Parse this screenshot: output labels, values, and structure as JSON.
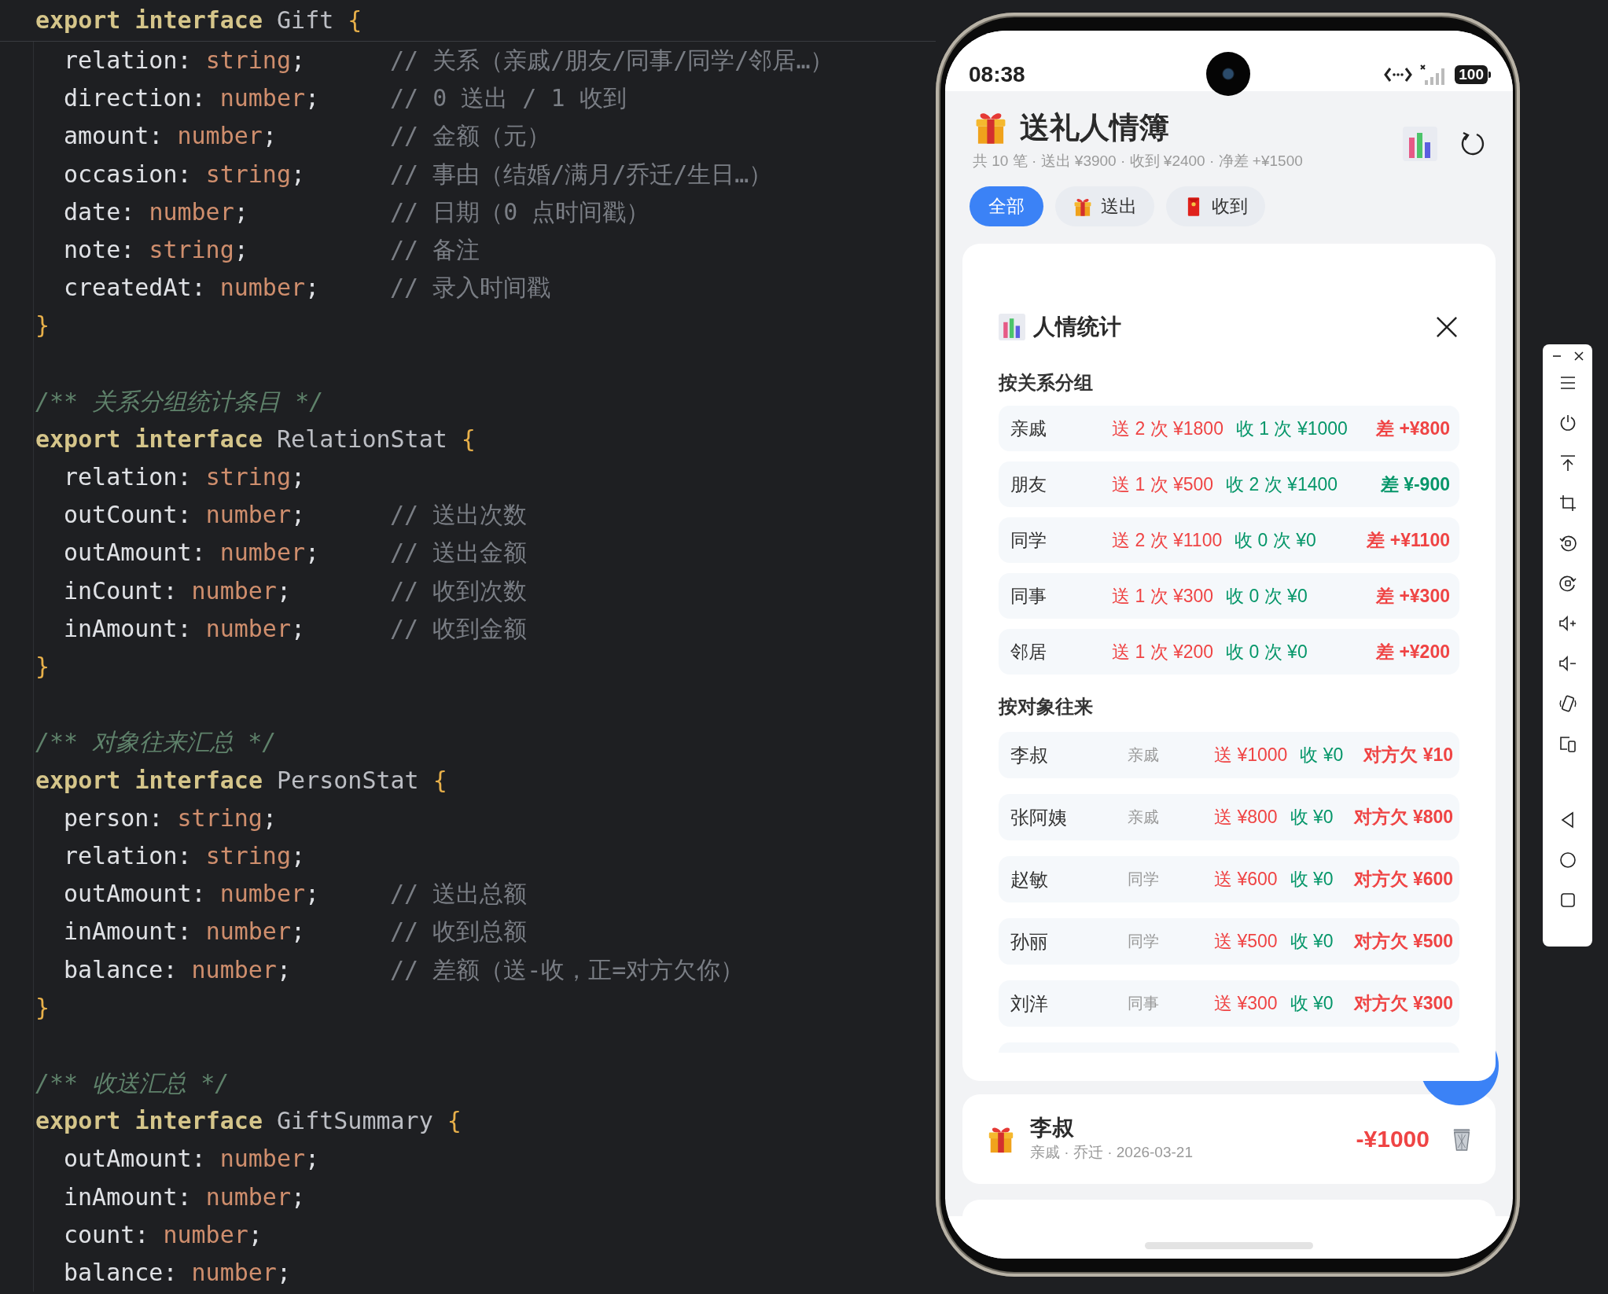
{
  "code": {
    "blocks": [
      {
        "sticky": true,
        "header": {
          "keyword": "export interface",
          "name": "Gift",
          "brace": "{"
        },
        "fields": [
          {
            "name": "relation:",
            "type": "string",
            "end": ";",
            "comment": "// 关系（亲戚/朋友/同事/同学/邻居…）"
          },
          {
            "name": "direction:",
            "type": "number",
            "end": ";",
            "comment": "// 0 送出 / 1 收到"
          },
          {
            "name": "amount:",
            "type": "number",
            "end": ";",
            "comment": "// 金额（元）"
          },
          {
            "name": "occasion:",
            "type": "string",
            "end": ";",
            "comment": "// 事由（结婚/满月/乔迁/生日…）"
          },
          {
            "name": "date:",
            "type": "number",
            "end": ";",
            "comment": "// 日期（0 点时间戳）"
          },
          {
            "name": "note:",
            "type": "string",
            "end": ";",
            "comment": "// 备注"
          },
          {
            "name": "createdAt:",
            "type": "number",
            "end": ";",
            "comment": "// 录入时间戳"
          }
        ],
        "closing": "}"
      },
      {
        "sticky": false,
        "doc": "/** 关系分组统计条目 */",
        "header": {
          "keyword": "export interface",
          "name": "RelationStat",
          "brace": "{"
        },
        "fields": [
          {
            "name": "relation:",
            "type": "string",
            "end": ";"
          },
          {
            "name": "outCount:",
            "type": "number",
            "end": ";",
            "comment": "// 送出次数"
          },
          {
            "name": "outAmount:",
            "type": "number",
            "end": ";",
            "comment": "// 送出金额"
          },
          {
            "name": "inCount:",
            "type": "number",
            "end": ";",
            "comment": "// 收到次数"
          },
          {
            "name": "inAmount:",
            "type": "number",
            "end": ";",
            "comment": "// 收到金额"
          }
        ],
        "closing": "}"
      },
      {
        "sticky": false,
        "doc": "/** 对象往来汇总 */",
        "header": {
          "keyword": "export interface",
          "name": "PersonStat",
          "brace": "{"
        },
        "fields": [
          {
            "name": "person:",
            "type": "string",
            "end": ";"
          },
          {
            "name": "relation:",
            "type": "string",
            "end": ";"
          },
          {
            "name": "outAmount:",
            "type": "number",
            "end": ";",
            "comment": "// 送出总额"
          },
          {
            "name": "inAmount:",
            "type": "number",
            "end": ";",
            "comment": "// 收到总额"
          },
          {
            "name": "balance:",
            "type": "number",
            "end": ";",
            "comment": "// 差额（送-收，正=对方欠你）"
          }
        ],
        "closing": "}"
      },
      {
        "sticky": false,
        "doc": "/** 收送汇总 */",
        "header": {
          "keyword": "export interface",
          "name": "GiftSummary",
          "brace": "{"
        },
        "fields": [
          {
            "name": "outAmount:",
            "type": "number",
            "end": ";"
          },
          {
            "name": "inAmount:",
            "type": "number",
            "end": ";"
          },
          {
            "name": "count:",
            "type": "number",
            "end": ";"
          },
          {
            "name": "balance:",
            "type": "number",
            "end": ";"
          }
        ]
      }
    ]
  },
  "phone": {
    "status_bar": {
      "time": "08:38",
      "battery": "100"
    },
    "header": {
      "title": "送礼人情簿",
      "summary": "共 10 笔 · 送出 ¥3900 · 收到 ¥2400 · 净差 +¥1500"
    },
    "tabs": [
      {
        "kind": "all",
        "label": "全部",
        "selected": true
      },
      {
        "kind": "out",
        "label": "送出",
        "selected": false
      },
      {
        "kind": "in",
        "label": "收到",
        "selected": false
      }
    ],
    "stats": {
      "title": "人情统计",
      "sections": [
        {
          "kind": "relation",
          "title": "按关系分组",
          "rows": [
            {
              "name": "亲戚",
              "out": "送 2 次 ¥1800",
              "in": "收 1 次 ¥1000",
              "diff": "差 +¥800",
              "color": "#ef4444"
            },
            {
              "name": "朋友",
              "out": "送 1 次 ¥500",
              "in": "收 2 次 ¥1400",
              "diff": "差 ¥-900",
              "color": "#059669"
            },
            {
              "name": "同学",
              "out": "送 2 次 ¥1100",
              "in": "收 0 次 ¥0",
              "diff": "差 +¥1100",
              "color": "#ef4444"
            },
            {
              "name": "同事",
              "out": "送 1 次 ¥300",
              "in": "收 0 次 ¥0",
              "diff": "差 +¥300",
              "color": "#ef4444"
            },
            {
              "name": "邻居",
              "out": "送 1 次 ¥200",
              "in": "收 0 次 ¥0",
              "diff": "差 +¥200",
              "color": "#ef4444"
            }
          ]
        },
        {
          "kind": "person",
          "title": "按对象往来",
          "rows": [
            {
              "name": "李叔",
              "relation": "亲戚",
              "out": "送 ¥1000",
              "in": "收 ¥0",
              "diff": "对方欠 ¥10",
              "color": "#ef4444"
            },
            {
              "name": "张阿姨",
              "relation": "亲戚",
              "out": "送 ¥800",
              "in": "收 ¥0",
              "diff": "对方欠 ¥800",
              "color": "#ef4444"
            },
            {
              "name": "赵敏",
              "relation": "同学",
              "out": "送 ¥600",
              "in": "收 ¥0",
              "diff": "对方欠 ¥600",
              "color": "#ef4444"
            },
            {
              "name": "孙丽",
              "relation": "同学",
              "out": "送 ¥500",
              "in": "收 ¥0",
              "diff": "对方欠 ¥500",
              "color": "#ef4444"
            },
            {
              "name": "刘洋",
              "relation": "同事",
              "out": "送 ¥300",
              "in": "收 ¥0",
              "diff": "对方欠 ¥300",
              "color": "#ef4444"
            }
          ]
        }
      ]
    },
    "records": [
      {
        "kind": "out",
        "name": "李叔",
        "meta": "亲戚 · 乔迁 · 2026-03-21",
        "amount": "-¥1000"
      }
    ]
  }
}
